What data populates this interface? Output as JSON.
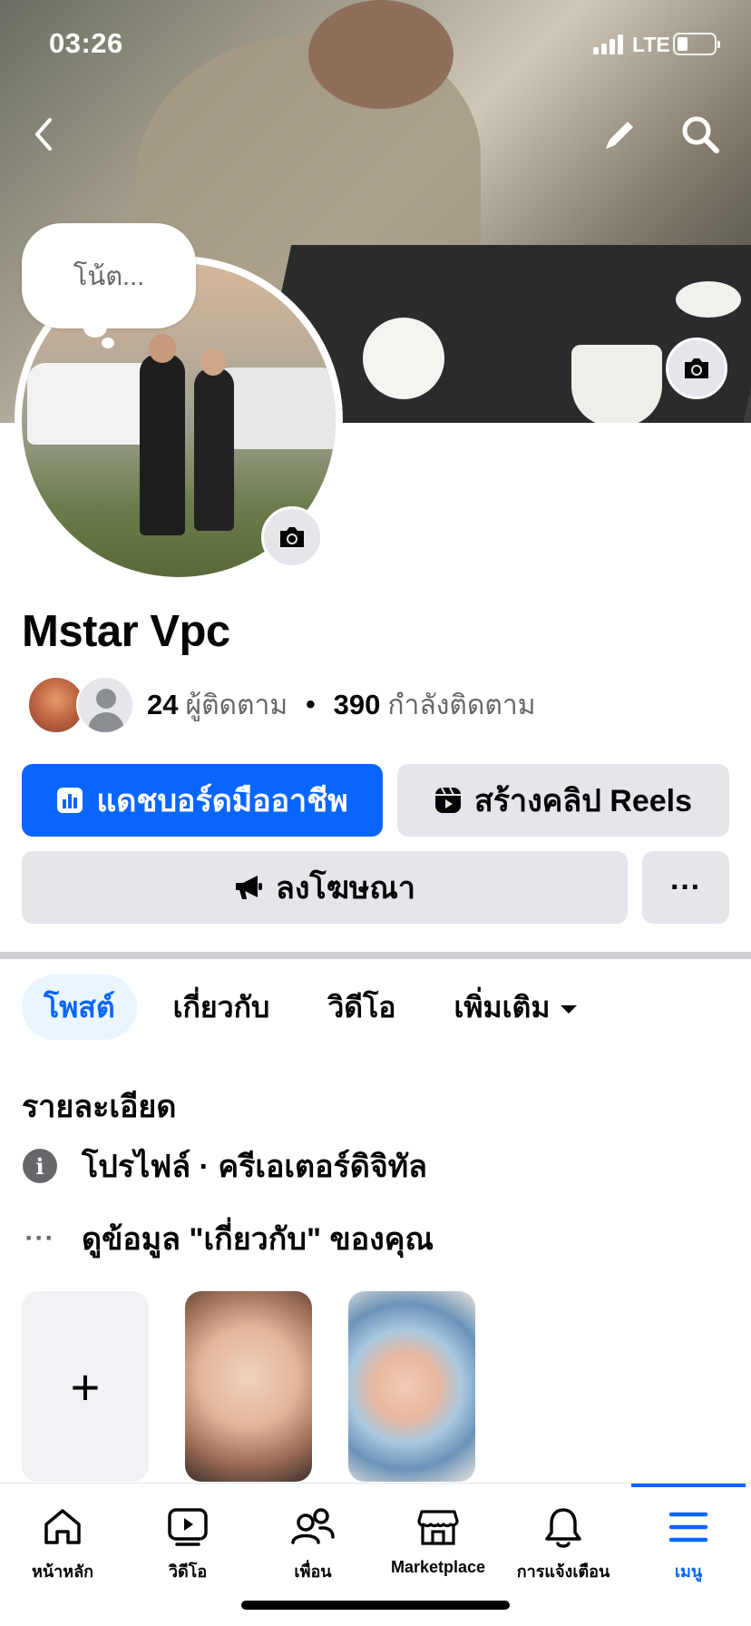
{
  "status_bar": {
    "time": "03:26",
    "network": "LTE"
  },
  "profile": {
    "note_text": "โน้ต...",
    "name": "Mstar Vpc",
    "followers_count": "24",
    "followers_label": "ผู้ติดตาม",
    "separator": "•",
    "following_count": "390",
    "following_label": "กำลังติดตาม"
  },
  "actions": {
    "dashboard_label": "แดชบอร์ดมืออาชีพ",
    "reels_label": "สร้างคลิป Reels",
    "ads_label": "ลงโฆษณา",
    "more_label": "···"
  },
  "tabs": [
    {
      "label": "โพสต์",
      "active": true
    },
    {
      "label": "เกี่ยวกับ",
      "active": false
    },
    {
      "label": "วิดีโอ",
      "active": false
    },
    {
      "label": "เพิ่มเติม",
      "active": false
    }
  ],
  "details": {
    "title": "รายละเอียด",
    "profile_type": "โปรไฟล์ · ครีเอเตอร์ดิจิทัล",
    "see_about": "ดูข้อมูล \"เกี่ยวกับ\" ของคุณ",
    "more_dots": "···"
  },
  "stories": {
    "add_label": "+"
  },
  "bottom_nav": [
    {
      "label": "หน้าหลัก",
      "icon": "home-icon",
      "active": false
    },
    {
      "label": "วิดีโอ",
      "icon": "video-icon",
      "active": false
    },
    {
      "label": "เพื่อน",
      "icon": "friends-icon",
      "active": false
    },
    {
      "label": "Marketplace",
      "icon": "marketplace-icon",
      "active": false
    },
    {
      "label": "การแจ้งเตือน",
      "icon": "bell-icon",
      "active": false
    },
    {
      "label": "เมนู",
      "icon": "menu-icon",
      "active": true
    }
  ],
  "colors": {
    "primary": "#0866ff",
    "secondary_bg": "#e4e6eb",
    "text": "#050505",
    "muted": "#65676b"
  }
}
